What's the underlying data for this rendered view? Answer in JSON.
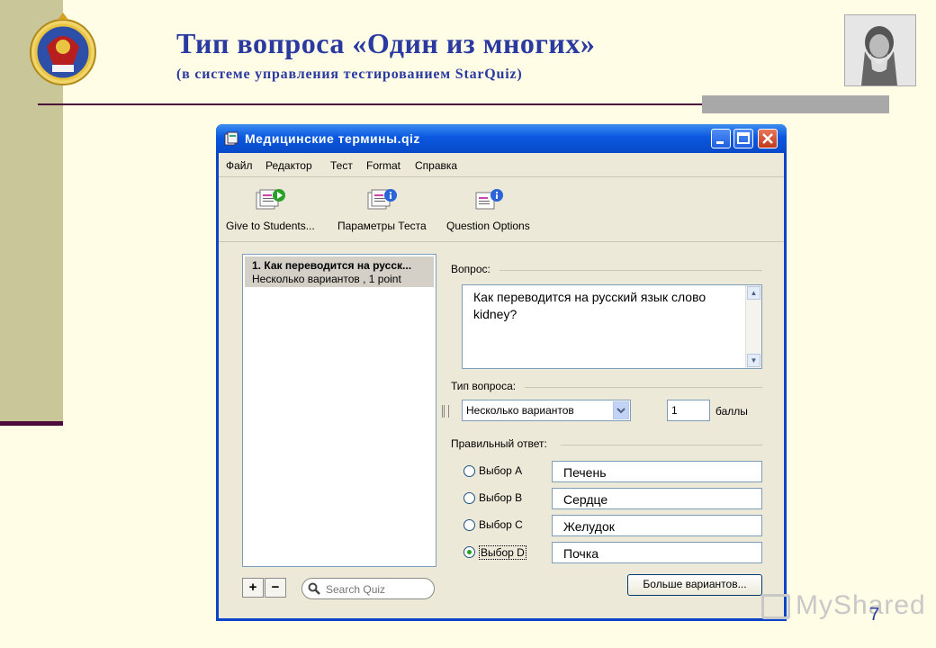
{
  "slide": {
    "title": "Тип вопроса «Один из многих»",
    "subtitle": "(в системе управления тестированием StarQuiz)",
    "page_number": "7",
    "watermark": "MyShared"
  },
  "window": {
    "title": "Медицинские термины.qiz"
  },
  "menu": [
    "Файл",
    "Редактор",
    "Тест",
    "Format",
    "Справка"
  ],
  "toolbar": {
    "give": "Give to Students...",
    "params": "Параметры Теста",
    "options": "Question Options"
  },
  "question_list": {
    "items": [
      {
        "title": "1. Как переводится на русск...",
        "detail": "Несколько вариантов , 1 point"
      }
    ],
    "search_placeholder": "Search Quiz"
  },
  "editor": {
    "question_label": "Вопрос:",
    "question_text": "Как переводится на русский язык слово kidney?",
    "type_label": "Тип вопроса:",
    "type_value": "Несколько вариантов",
    "points_value": "1",
    "points_label": "баллы",
    "answer_label": "Правильный ответ:",
    "choices": [
      {
        "label": "Выбор A",
        "value": "Печень",
        "selected": false
      },
      {
        "label": "Выбор B",
        "value": "Сердце",
        "selected": false
      },
      {
        "label": "Выбор C",
        "value": "Желудок",
        "selected": false
      },
      {
        "label": "Выбор D",
        "value": "Почка",
        "selected": true
      }
    ],
    "more_button": "Больше вариантов..."
  },
  "colors": {
    "title_blue": "#2a3aa0",
    "xp_titlebar": "#0a58e0",
    "window_face": "#ece9d8",
    "slide_bg": "#fffde6"
  }
}
